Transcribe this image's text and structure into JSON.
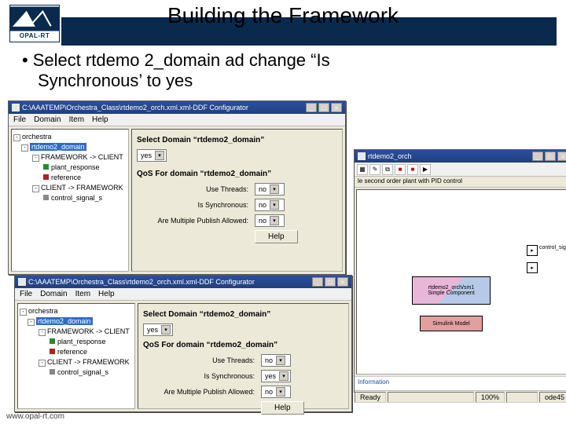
{
  "slide": {
    "logo_text": "OPAL-RT",
    "title": "Building the Framework",
    "bullet_l1": "Select rtdemo 2_domain ad change “Is",
    "bullet_l2": "Synchronous’ to yes",
    "footer": "www.opal-rt.com"
  },
  "win1": {
    "title": "C:\\AAATEMP\\Orchestra_Class\\rtdemo2_orch.xml.xml-DDF Configurator",
    "menu": [
      "File",
      "Domain",
      "Item",
      "Help"
    ],
    "tree": {
      "root": "orchestra",
      "sel": "rtdemo2_domain",
      "n1": "FRAMEWORK -> CLIENT",
      "n1a": "plant_response",
      "n1b": "reference",
      "n2": "CLIENT -> FRAMEWORK",
      "n2a": "control_signal_s"
    },
    "pane": {
      "heading": "Select Domain “rtdemo2_domain”",
      "yes": "yes",
      "q_heading": "QoS For domain “rtdemo2_domain”",
      "r1": "Use Threads:",
      "v1": "no",
      "r2": "Is Synchronous:",
      "v2": "no",
      "r3": "Are Multiple Publish Allowed:",
      "v3": "no",
      "help": "Help"
    }
  },
  "win2": {
    "title": "C:\\AAATEMP\\Orchestra_Class\\rtdemo2_orch.xml.xml-DDF Configurator",
    "menu": [
      "File",
      "Domain",
      "Item",
      "Help"
    ],
    "tree": {
      "root": "orchestra",
      "sel": "rtdemo2_domain",
      "n1": "FRAMEWORK -> CLIENT",
      "n1a": "plant_response",
      "n1b": "reference",
      "n2": "CLIENT -> FRAMEWORK",
      "n2a": "control_signal_s"
    },
    "pane": {
      "heading": "Select Domain “rtdemo2_domain”",
      "yes": "yes",
      "q_heading": "QoS For domain “rtdemo2_domain”",
      "r1": "Use Threads:",
      "v1": "no",
      "r2": "Is Synchronous:",
      "v2": "yes",
      "r3": "Are Multiple Publish Allowed:",
      "v3": "no",
      "help": "Help"
    }
  },
  "sim": {
    "title": "rtdemo2_orch",
    "blk1_l1": "rtdemo2_orch/sm1",
    "blk1_l2": "Simple Component",
    "blk2": "Simulink Model",
    "out": "control_signal_s",
    "note": "Information",
    "status_ready": "Ready",
    "status_pct": "100%",
    "status_mode": "ode45"
  }
}
